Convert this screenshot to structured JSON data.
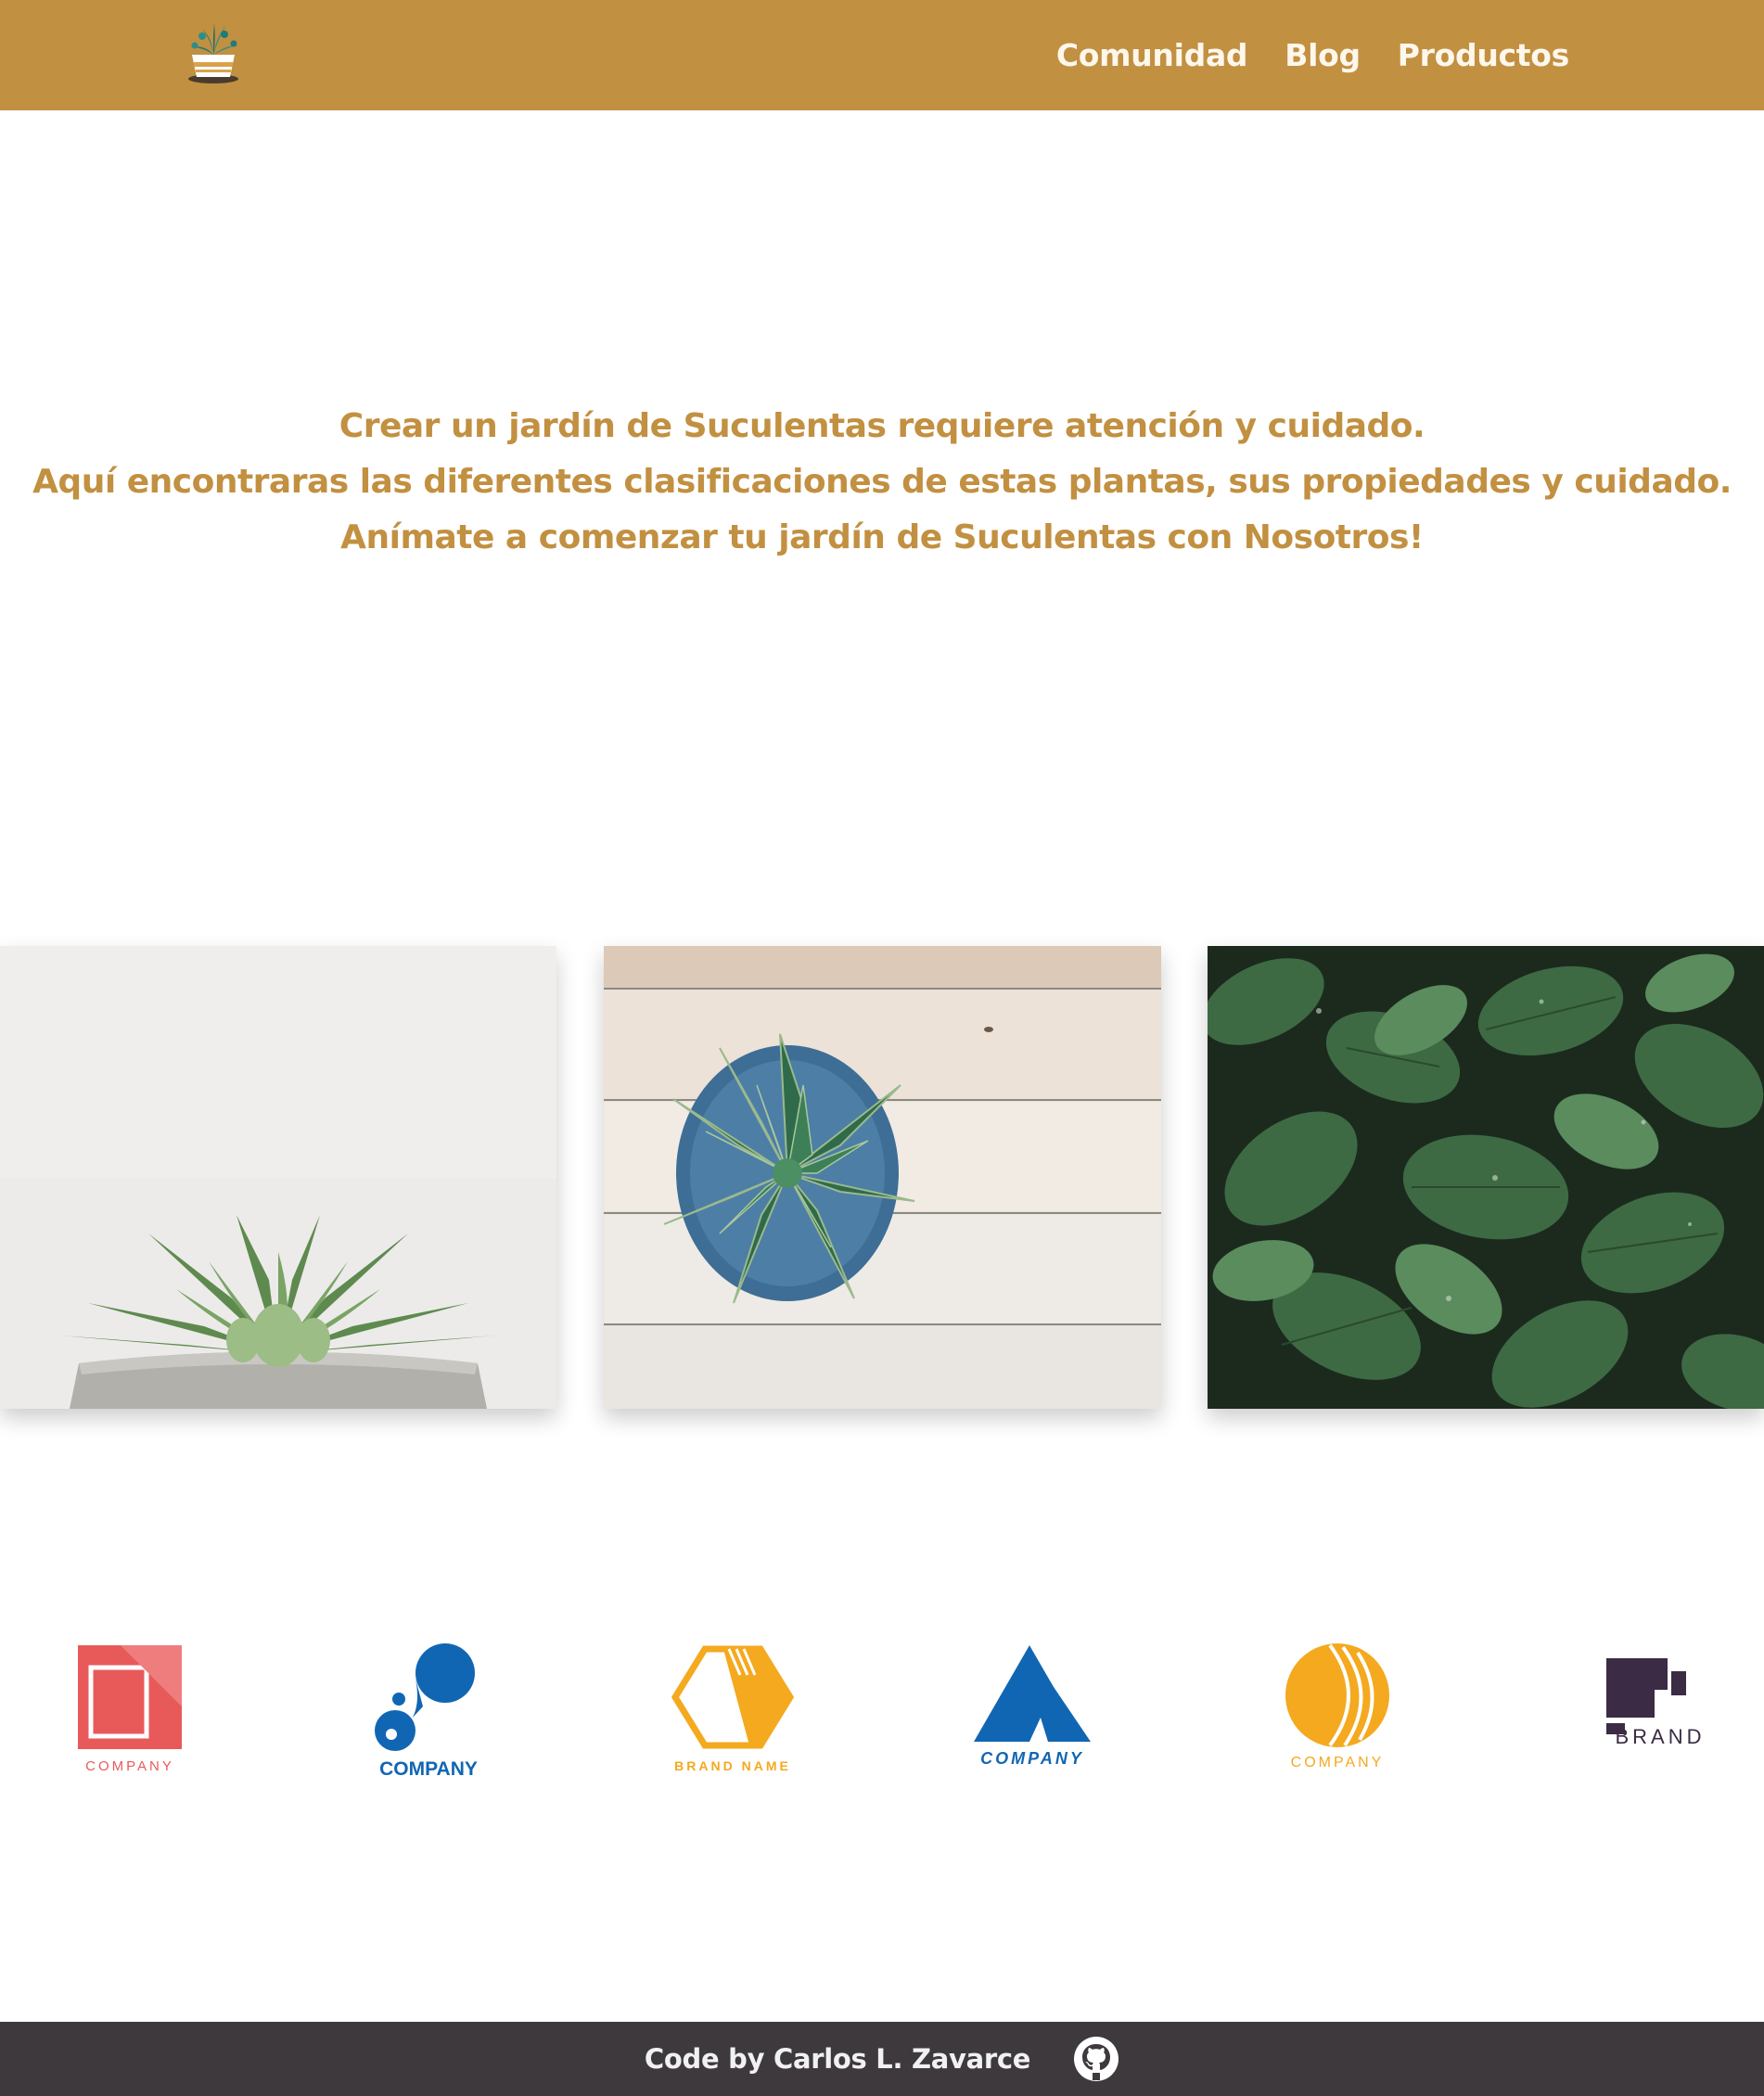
{
  "header": {
    "nav": [
      {
        "label": "Comunidad"
      },
      {
        "label": "Blog"
      },
      {
        "label": "Productos"
      }
    ]
  },
  "intro": {
    "lines": [
      "Crear un jardín de Suculentas requiere atención y cuidado.",
      "Aquí encontraras las diferentes clasificaciones de estas plantas, sus propiedades y cuidado.",
      "Anímate a comenzar tu jardín de Suculentas con Nosotros!"
    ]
  },
  "brands": [
    {
      "name": "COMPANY",
      "color": "#e85a5a"
    },
    {
      "name": "COMPANY",
      "color": "#1166b3"
    },
    {
      "name": "BRAND NAME",
      "color": "#f4a91e"
    },
    {
      "name": "COMPANY",
      "color": "#1166b3"
    },
    {
      "name": "COMPANY",
      "color": "#f4a91e"
    },
    {
      "name": "BRAND",
      "color": "#3b2b44"
    }
  ],
  "footer": {
    "credit": "Code by Carlos L. Zavarce"
  },
  "colors": {
    "brand": "#c29041",
    "footer_bg": "#3d393d"
  }
}
